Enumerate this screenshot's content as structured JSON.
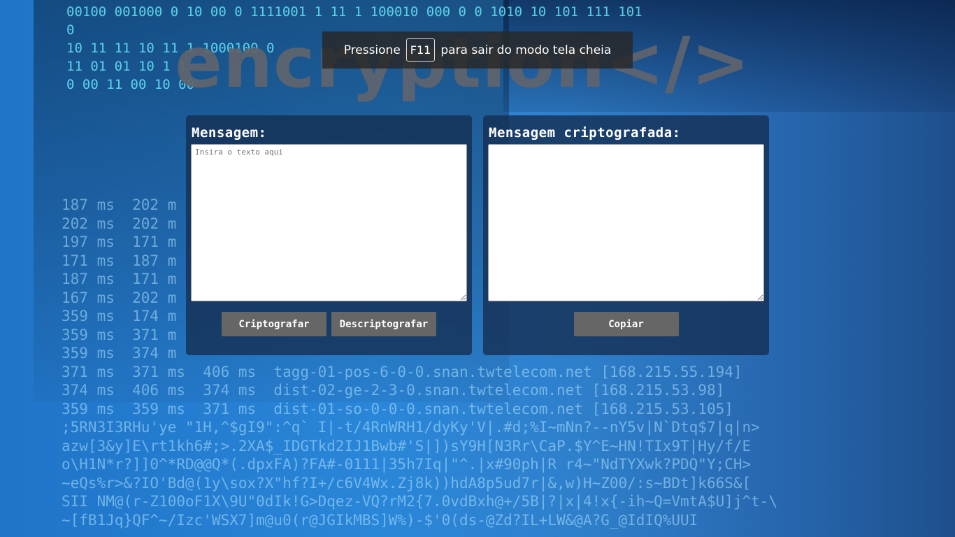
{
  "logo": {
    "text": "encryption</>"
  },
  "fullscreen_notice": {
    "prefix": "Pressione",
    "key": "F11",
    "suffix": "para sair do modo tela cheia"
  },
  "input_panel": {
    "title": "Mensagem:",
    "placeholder": "Insira o texto aqui",
    "value": "",
    "encrypt_label": "Criptografar",
    "decrypt_label": "Descriptografar"
  },
  "output_panel": {
    "title": "Mensagem criptografada:",
    "value": "",
    "copy_label": "Copiar"
  }
}
